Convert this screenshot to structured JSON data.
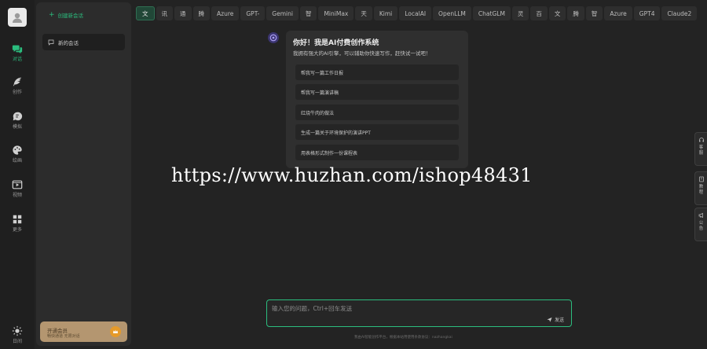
{
  "nav": {
    "items": [
      {
        "label": "对话",
        "icon": "chat-icon",
        "active": true
      },
      {
        "label": "创作",
        "icon": "feather-icon",
        "active": false
      },
      {
        "label": "模拟",
        "icon": "brain-icon",
        "active": false
      },
      {
        "label": "绘画",
        "icon": "palette-icon",
        "active": false
      },
      {
        "label": "视频",
        "icon": "video-icon",
        "active": false
      },
      {
        "label": "更多",
        "icon": "grid-icon",
        "active": false
      }
    ],
    "theme_label": "日间"
  },
  "sidebar": {
    "new_chat_label": "创建新会话",
    "conversations": [
      {
        "title": "新的会话"
      }
    ],
    "vip": {
      "title": "开通会员",
      "subtitle": "畅快通道 无限对话"
    }
  },
  "tabs": [
    "文",
    "讯",
    "通",
    "腾",
    "Azure",
    "GPT-",
    "Gemini",
    "智",
    "MiniMax",
    "天",
    "Kimi",
    "LocalAI",
    "OpenLLM",
    "ChatGLM",
    "灵",
    "百",
    "文",
    "腾",
    "智",
    "Azure",
    "GPT4",
    "Claude2"
  ],
  "welcome": {
    "title": "你好！我是AI付费创作系统",
    "subtitle": "我拥有强大的AI引擎，可以辅助你快速写作，赶快试一试吧！",
    "suggestions": [
      "帮我写一篇工作日报",
      "帮我写一篇演讲稿",
      "红烧牛肉的做法",
      "生成一篇关于环境保护的演讲PPT",
      "用表格形式制作一份课程表"
    ]
  },
  "watermark": "https://www.huzhan.com/ishop48431",
  "side_buttons": [
    {
      "label": "客服",
      "icon": "headset-icon"
    },
    {
      "label": "教程",
      "icon": "book-icon"
    },
    {
      "label": "公告",
      "icon": "megaphone-icon"
    }
  ],
  "input": {
    "placeholder": "输入您的问题，Ctrl+回车发送",
    "send_label": "发送"
  },
  "footer": "我由AI智能创作平台，根据本站用使用条款协议：nazhangkai",
  "colors": {
    "accent": "#2bbd7e",
    "background": "#232323",
    "panel": "#2c2c2c",
    "vip": "#b49670"
  }
}
